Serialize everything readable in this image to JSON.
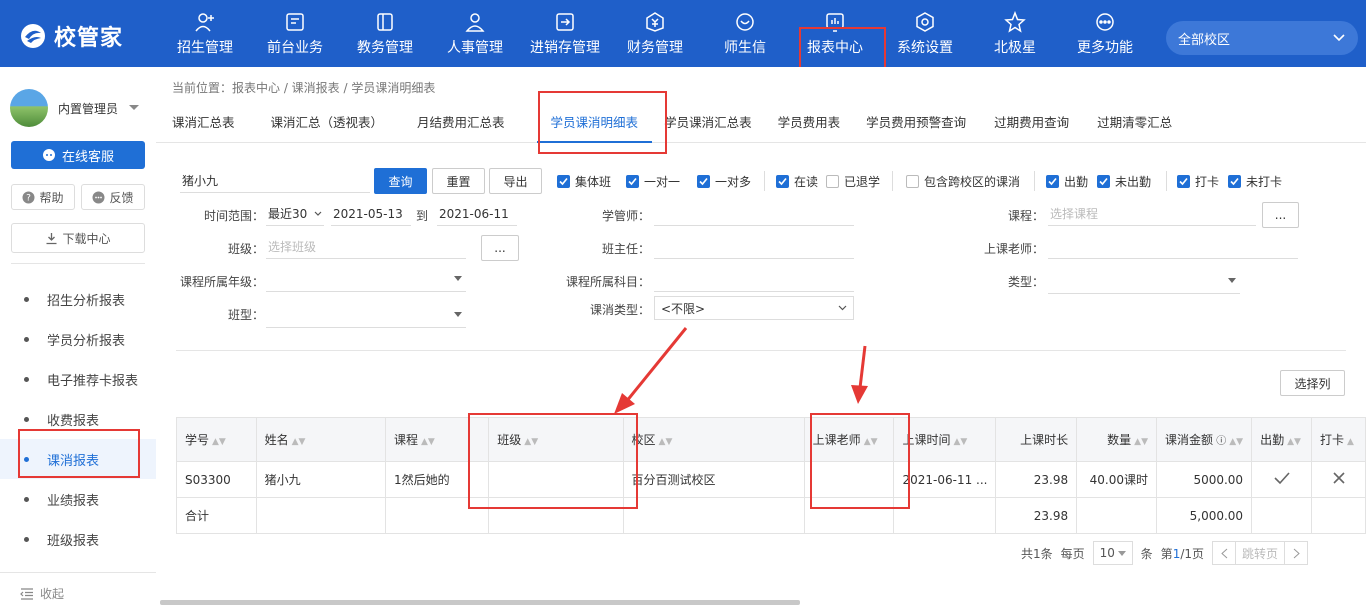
{
  "brand": {
    "name": "校管家"
  },
  "nav": [
    {
      "label": "招生管理",
      "icon": "add-user-icon"
    },
    {
      "label": "前台业务",
      "icon": "monitor-icon"
    },
    {
      "label": "教务管理",
      "icon": "book-icon"
    },
    {
      "label": "人事管理",
      "icon": "person-icon"
    },
    {
      "label": "进销存管理",
      "icon": "exchange-icon"
    },
    {
      "label": "财务管理",
      "icon": "money-icon"
    },
    {
      "label": "师生信",
      "icon": "chat-icon"
    },
    {
      "label": "报表中心",
      "icon": "report-icon"
    },
    {
      "label": "系统设置",
      "icon": "settings-icon"
    },
    {
      "label": "北极星",
      "icon": "star-icon"
    },
    {
      "label": "更多功能",
      "icon": "more-icon"
    }
  ],
  "campus": {
    "label": "全部校区"
  },
  "sidebar": {
    "username": "内置管理员",
    "online_service": "在线客服",
    "help": "帮助",
    "feedback": "反馈",
    "download": "下载中心",
    "items": [
      {
        "label": "招生分析报表"
      },
      {
        "label": "学员分析报表"
      },
      {
        "label": "电子推荐卡报表"
      },
      {
        "label": "收费报表"
      },
      {
        "label": "课消报表"
      },
      {
        "label": "业绩报表"
      },
      {
        "label": "班级报表"
      }
    ],
    "collapse": "收起"
  },
  "breadcrumb": "当前位置：报表中心 / 课消报表 / 学员课消明细表",
  "tabs": [
    {
      "label": "课消汇总表"
    },
    {
      "label": "课消汇总（透视表）"
    },
    {
      "label": "月结费用汇总表"
    },
    {
      "label": "学员课消明细表"
    },
    {
      "label": "学员课消汇总表"
    },
    {
      "label": "学员费用表"
    },
    {
      "label": "学员费用预警查询"
    },
    {
      "label": "过期费用查询"
    },
    {
      "label": "过期清零汇总"
    }
  ],
  "filters": {
    "keyword": "猪小九",
    "query": "查询",
    "reset": "重置",
    "export": "导出",
    "checkboxes": [
      {
        "label": "集体班",
        "checked": true
      },
      {
        "label": "一对一",
        "checked": true
      },
      {
        "label": "一对多",
        "checked": true
      },
      {
        "label": "在读",
        "checked": true
      },
      {
        "label": "已退学",
        "checked": false
      },
      {
        "label": "包含跨校区的课消",
        "checked": false
      },
      {
        "label": "出勤",
        "checked": true
      },
      {
        "label": "未出勤",
        "checked": true
      },
      {
        "label": "打卡",
        "checked": true
      },
      {
        "label": "未打卡",
        "checked": true
      }
    ],
    "time_range_label": "时间范围：",
    "time_range_value": "最近30",
    "date_from": "2021-05-13",
    "date_to_sep": "到",
    "date_to": "2021-06-11",
    "class_label": "班级：",
    "class_placeholder": "选择班级",
    "grade_label": "课程所属年级：",
    "classtype_label": "班型：",
    "tutor_label": "学管师：",
    "headteacher_label": "班主任：",
    "subject_label": "课程所属科目：",
    "consume_type_label": "课消类型：",
    "consume_type_value": "<不限>",
    "course_label": "课程：",
    "course_placeholder": "选择课程",
    "teacher_label": "上课老师：",
    "type_label": "类型：",
    "more": "...",
    "select_columns": "选择列"
  },
  "table": {
    "headers": [
      "学号",
      "姓名",
      "课程",
      "班级",
      "校区",
      "上课老师",
      "上课时间",
      "上课时长",
      "数量",
      "课消金额",
      "出勤",
      "打卡"
    ],
    "rows": [
      {
        "cells": [
          "S03300",
          "猪小九",
          "1然后她的",
          "",
          "百分百测试校区",
          "",
          "2021-06-11 ...",
          "23.98",
          "40.00课时",
          "5000.00"
        ]
      }
    ],
    "total": {
      "label": "合计",
      "duration": "23.98",
      "amount": "5,000.00"
    }
  },
  "pager": {
    "total": "共1条",
    "per_page_label": "每页",
    "per_page": "10",
    "unit": "条",
    "page_prefix": "第",
    "page_current": "1",
    "page_suffix": "/1页",
    "jump": "跳转页"
  },
  "colors": {
    "primary": "#1f6fd6",
    "topbar": "#1f5fc9",
    "highlight": "#e53935"
  }
}
